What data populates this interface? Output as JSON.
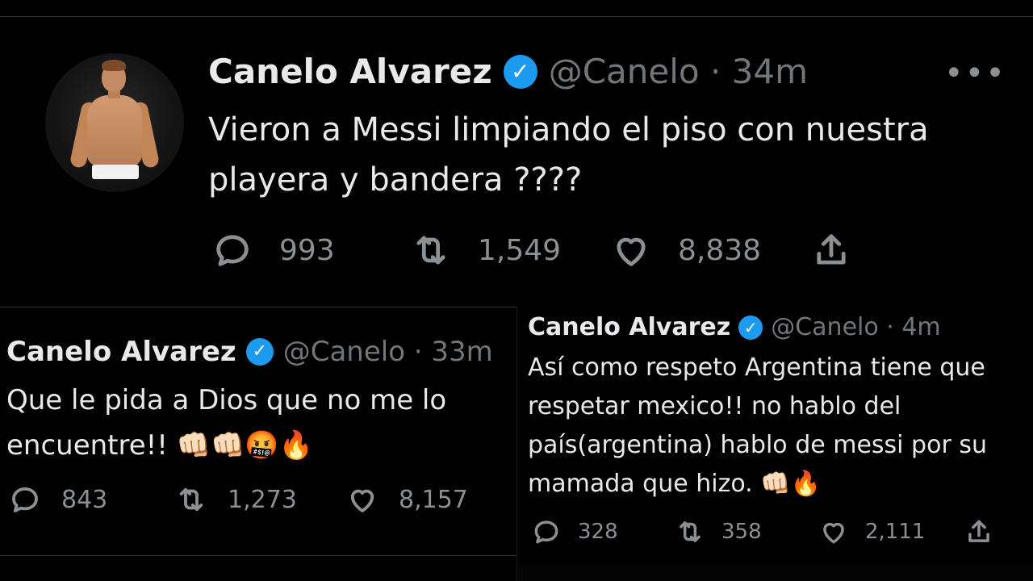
{
  "main_tweet": {
    "name": "Canelo Alvarez",
    "handle_time": "@Canelo · 34m",
    "more": "•••",
    "text": "Vieron a Messi limpiando el piso con nuestra playera y bandera ????",
    "replies": "993",
    "retweets": "1,549",
    "likes": "8,838"
  },
  "left_tweet": {
    "name": "Canelo Alvarez",
    "handle_time": "@Canelo · 33m",
    "text": "Que le pida a Dios que no me lo encuentre!! 👊🏻👊🏻🤬🔥",
    "replies": "843",
    "retweets": "1,273",
    "likes": "8,157"
  },
  "right_tweet": {
    "name": "Canelo Alvarez",
    "handle_time": "@Canelo · 4m",
    "text": "Así como respeto Argentina tiene que respetar mexico!! no hablo del país(argentina) hablo de messi por su mamada que hizo. 👊🏻🔥",
    "replies": "328",
    "retweets": "358",
    "likes": "2,111"
  },
  "colors": {
    "background": "#000000",
    "text": "#e7e9ea",
    "secondary": "#71767b",
    "verified": "#1d9bf0",
    "divider": "#2f3336"
  },
  "icons": {
    "reply": "reply-icon",
    "retweet": "retweet-icon",
    "like": "like-icon",
    "share": "share-icon",
    "verified": "verified-badge-icon",
    "more": "more-icon"
  }
}
